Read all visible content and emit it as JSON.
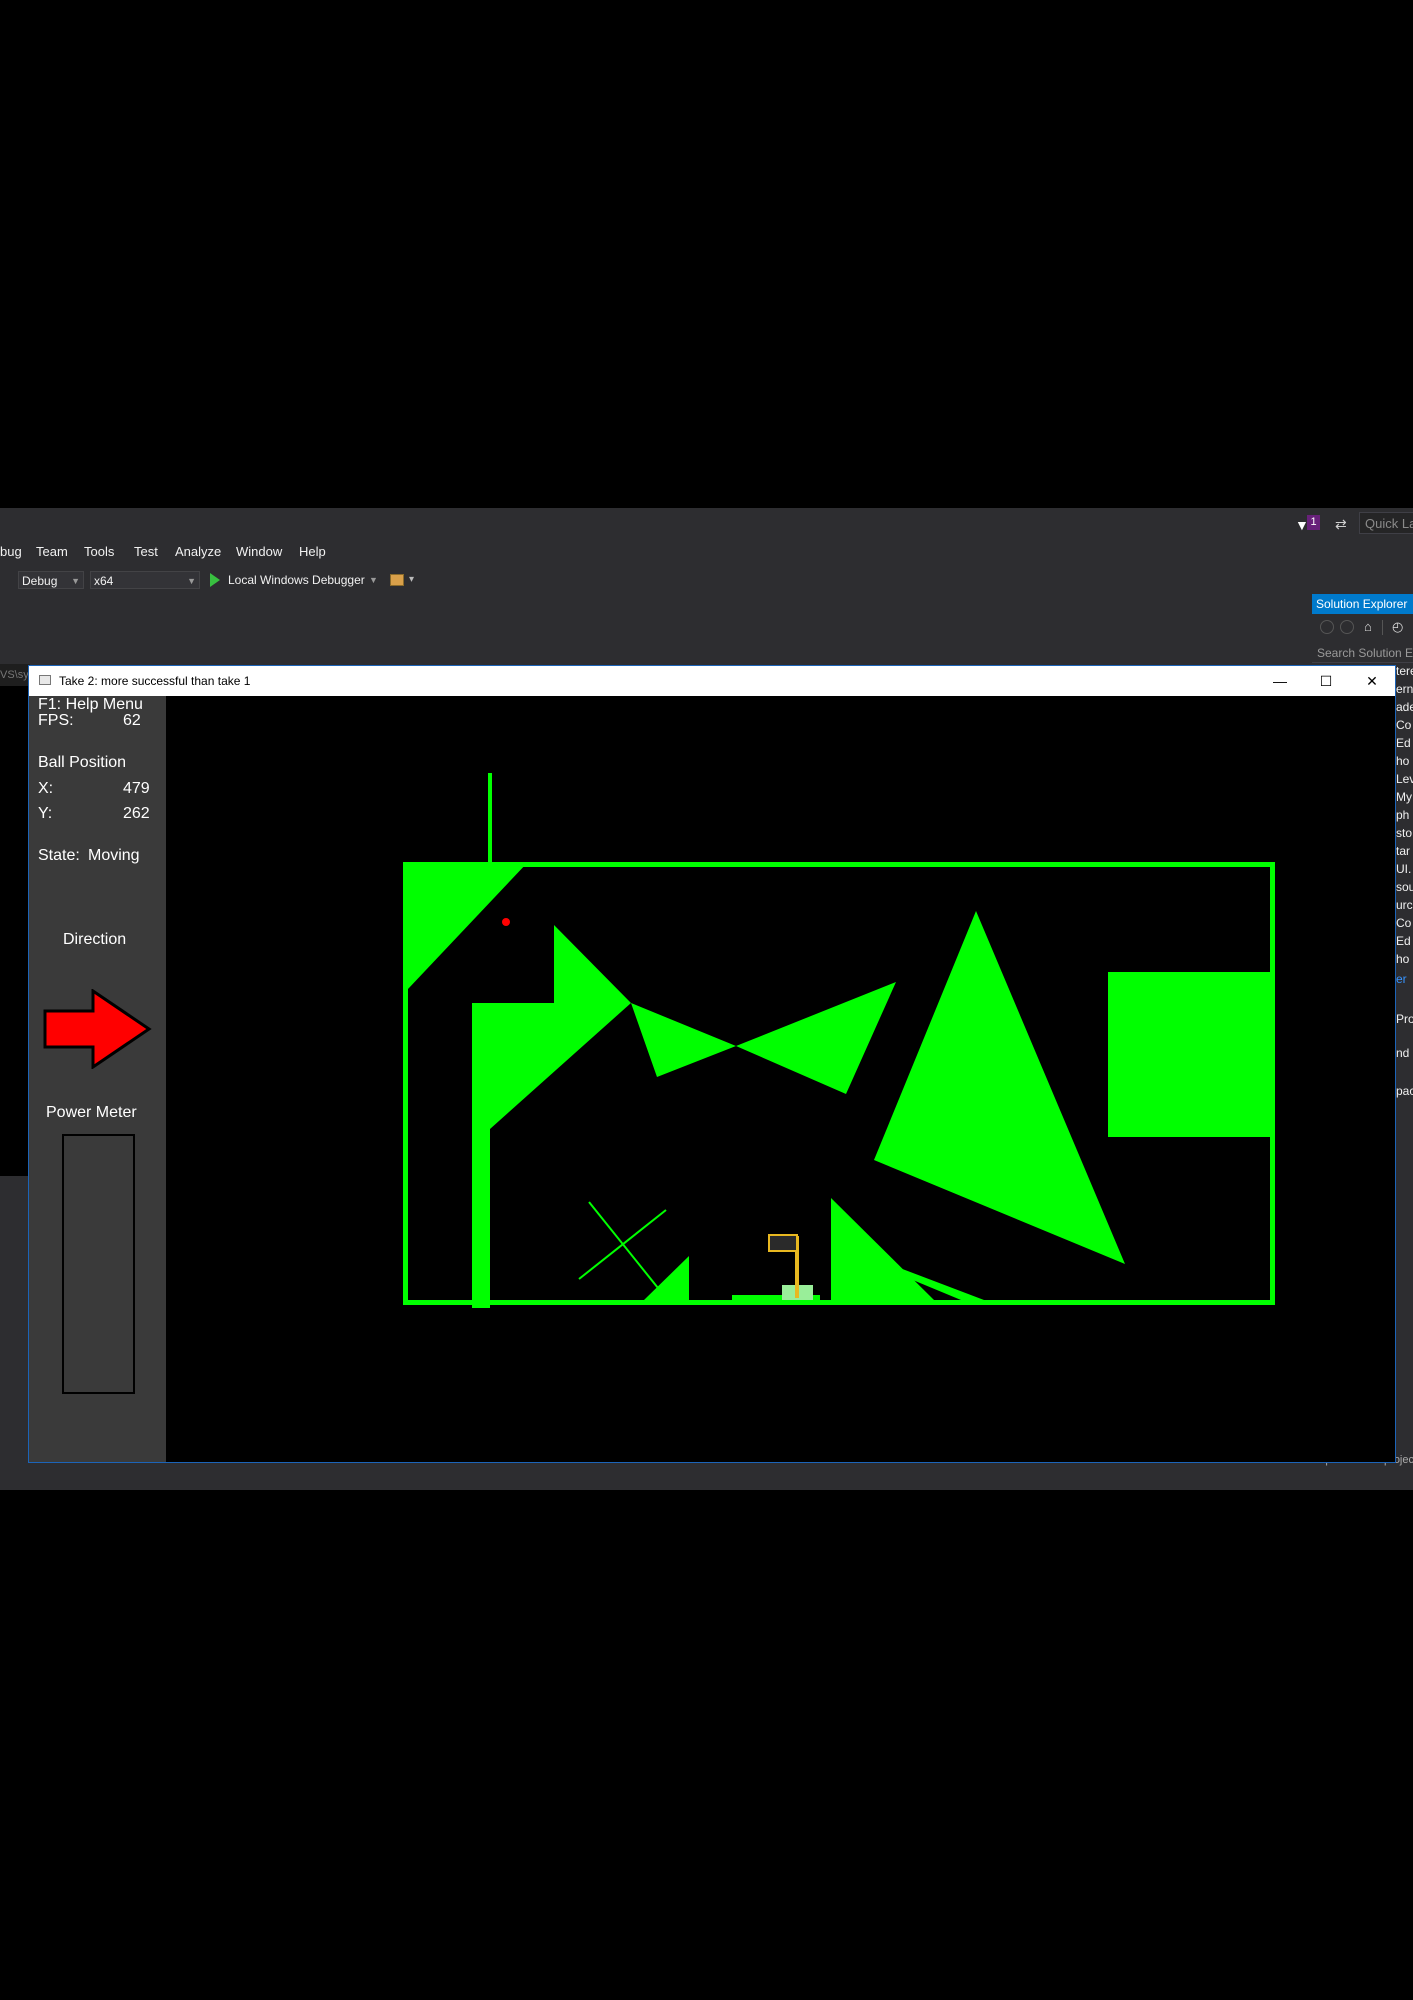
{
  "vs": {
    "notification_count": "1",
    "quick_launch": "Quick Launch",
    "menu": [
      "bug",
      "Team",
      "Tools",
      "Test",
      "Analyze",
      "Window",
      "Help"
    ],
    "toolbar": {
      "config": "Debug",
      "platform": "x64",
      "debugger": "Local Windows Debugger"
    },
    "left_path": "VS\\sys",
    "solution_explorer": {
      "title": "Solution Explorer",
      "search_placeholder": "Search Solution Explorer",
      "tree": [
        "tere",
        "ern",
        "ade",
        "Co",
        "Ed",
        "ho",
        "Lev",
        "My",
        "ph",
        "sto",
        "tar",
        "UI.",
        "sou",
        "urce",
        "Co",
        "Ed",
        "ho",
        "er",
        "Pro",
        "nd",
        "pac"
      ],
      "footer": "Specifies the project"
    },
    "accent_color": "#007acc"
  },
  "game_window": {
    "title": "Take 2: more successful than take 1",
    "controls": {
      "minimize": "—",
      "maximize": "☐",
      "close": "✕"
    }
  },
  "hud": {
    "help": "F1: Help Menu",
    "fps_label": "FPS:",
    "fps_value": "62",
    "ball_position_label": "Ball Position",
    "x_label": "X:",
    "x_value": "479",
    "y_label": "Y:",
    "y_value": "262",
    "state_label": "State:",
    "state_value": "Moving",
    "direction_label": "Direction",
    "direction_icon": "right-arrow-icon",
    "power_meter_label": "Power Meter",
    "power_level": 0
  },
  "level": {
    "geometry_color": "#00ff00",
    "ball_color": "#ff0000",
    "flag_color": "#e8b820"
  }
}
